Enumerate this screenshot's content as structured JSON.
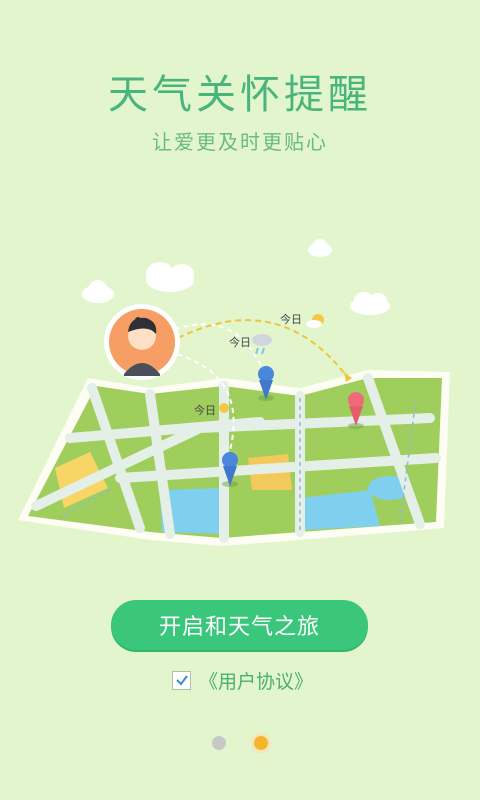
{
  "onboarding": {
    "title": "天气关怀提醒",
    "subtitle": "让爱更及时更贴心",
    "cta_label": "开启和天气之旅",
    "agreement_label": "《用户协议》",
    "agreement_checked": true,
    "today_labels": [
      "今日",
      "今日",
      "今日"
    ],
    "page_indicator": {
      "current": 2,
      "total": 2
    }
  },
  "colors": {
    "background": "#e3f5cc",
    "accent": "#3ac77c",
    "dot_active": "#f5b52a",
    "dot_inactive": "#c8c8c8"
  },
  "icons": [
    "cloud-icon",
    "avatar",
    "location-pin-icon",
    "rain-icon",
    "sun-icon",
    "checkmark-icon"
  ]
}
